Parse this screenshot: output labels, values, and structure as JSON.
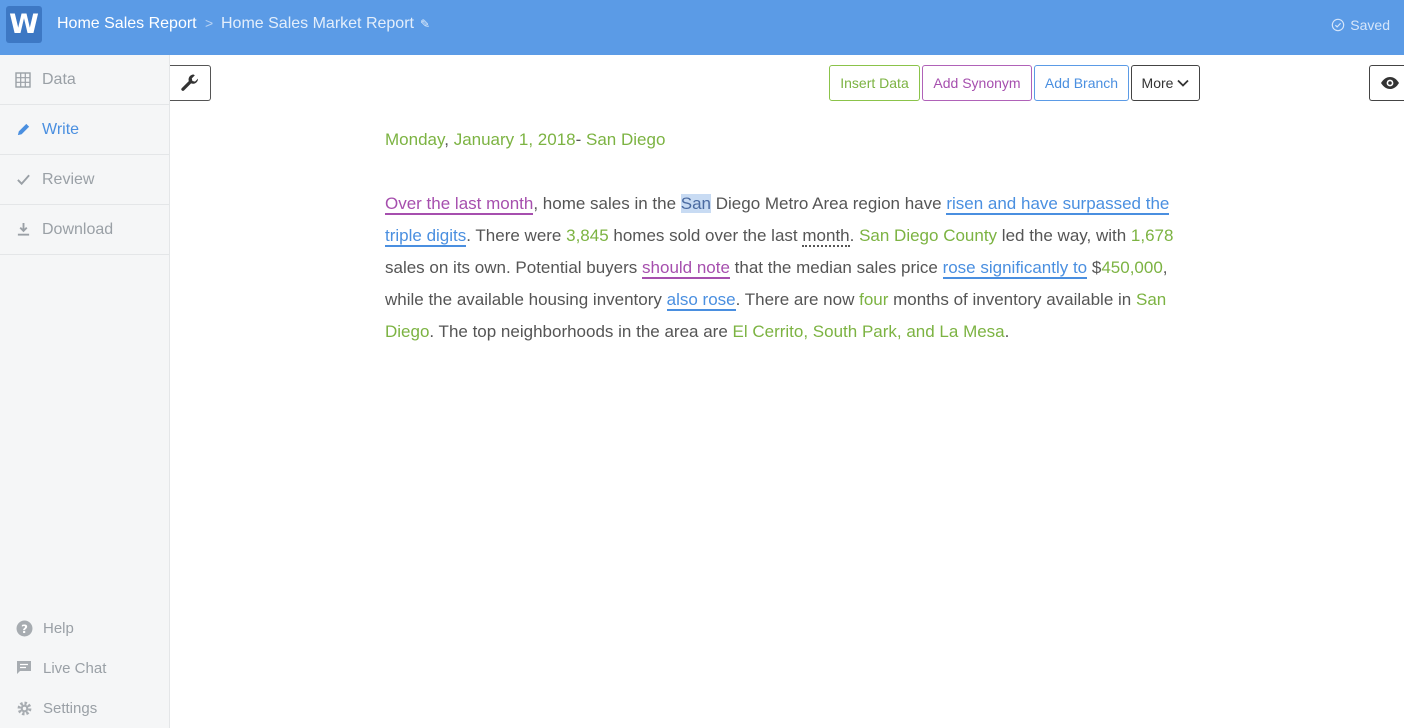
{
  "header": {
    "logo": "W",
    "breadcrumb_project": "Home Sales Report",
    "breadcrumb_separator": ">",
    "breadcrumb_report": "Home Sales Market Report",
    "saved_status": "Saved"
  },
  "sidebar": {
    "items": [
      {
        "label": "Data",
        "icon": "grid-icon"
      },
      {
        "label": "Write",
        "icon": "pencil-icon"
      },
      {
        "label": "Review",
        "icon": "check-icon"
      },
      {
        "label": "Download",
        "icon": "download-icon"
      }
    ],
    "bottom": [
      {
        "label": "Help",
        "icon": "help-icon"
      },
      {
        "label": "Live Chat",
        "icon": "chat-icon"
      },
      {
        "label": "Settings",
        "icon": "gear-icon"
      }
    ]
  },
  "toolbar": {
    "insert_data": "Insert Data",
    "add_synonym": "Add Synonym",
    "add_branch": "Add Branch",
    "more": "More"
  },
  "document": {
    "date_day": "Monday",
    "date_comma": ",",
    "date_full": "January 1, 2018",
    "date_dash": "-",
    "date_city": "San Diego",
    "p": {
      "s1": "Over the last month",
      "t1": ", home sales in the ",
      "t1sel": "San",
      "t1b": " Diego Metro Area region have ",
      "s2": "risen and have surpassed the triple digits",
      "t2": ". There were ",
      "d1": "3,845",
      "t3": " homes sold over the last ",
      "dot1": "month",
      "t4": ". ",
      "d2": "San Diego County",
      "t5": " led the way, with ",
      "d3": "1,678",
      "t6": " sales on its own. Potential buyers ",
      "s3": "should note",
      "t7": " that the median sales price ",
      "s4": "rose significantly to",
      "t8": " $",
      "d4": "450,000",
      "t9": ", while the available housing inventory ",
      "s5": "also rose",
      "t10": ". There are now ",
      "d5": "four",
      "t11": " months of inventory available in ",
      "d6": "San Diego",
      "t12": ". The top neighborhoods in the area are ",
      "d7": "El Cerrito, South Park, and La Mesa",
      "t13": "."
    }
  },
  "colors": {
    "header": "#5b9be6",
    "data": "#7cb342",
    "synonym": "#a64fae",
    "branch": "#4a8fe0"
  }
}
